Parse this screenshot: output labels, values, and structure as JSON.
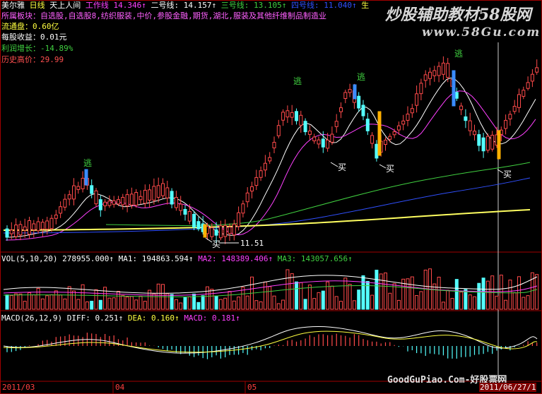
{
  "header": {
    "stock_name": "美尔雅",
    "period": "日线",
    "indicator_name": "天上人间",
    "line1_label": "工作线",
    "line1_value": "14.346↑",
    "line2_label": "二号线:",
    "line2_value": "14.157↑",
    "line3_label": "三号线:",
    "line3_value": "13.105↑",
    "line4_label": "四号线:",
    "line4_value": "11.040↑",
    "tail": "生"
  },
  "info": {
    "sectors": "所属板块：自选股,自选股8,纺织服装,中价,参股金融,期货,湖北,服装及其他纤维制品制造业",
    "float_cap": "流通盘：0.60亿",
    "eps": "每股收益：0.01元",
    "profit_growth": "利润增长：-14.89%",
    "historic_high": "历史高价：29.99"
  },
  "watermark": {
    "title": "炒股辅助教材58股网",
    "url": "www.58Gu.com",
    "bottom": "GoodGuPiao.Com-好股票网"
  },
  "annotations": {
    "escape": "逃",
    "buy": "买",
    "low_price": "11.51"
  },
  "volume_panel": {
    "label": "VOL(5,10,20)",
    "vol_value": "278955.000↑",
    "ma1": "MA1: 194863.594↑",
    "ma2": "MA2: 148389.406↑",
    "ma3": "MA3: 143057.656↑"
  },
  "macd_panel": {
    "label": "MACD(26,12,9)",
    "diff": "DIFF: 0.251↑",
    "dea": "DEA: 0.160↑",
    "macd": "MACD: 0.181↑"
  },
  "date_axis": {
    "labels": [
      "2011/03",
      "04",
      "05"
    ],
    "current_date": "2011/06/27/1"
  },
  "colors": {
    "up": "#ff4a4a",
    "down": "#54ffff",
    "ma_white": "#ffffff",
    "ma_magenta": "#ff40ff",
    "ma_green": "#40d040",
    "ma_blue": "#3050ff",
    "ma_yellow": "#ffff60",
    "label_pink": "#ff60ff",
    "label_yellow": "#ffff40",
    "label_orange": "#ff9040"
  }
}
